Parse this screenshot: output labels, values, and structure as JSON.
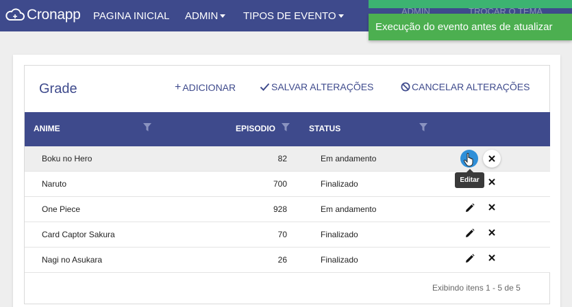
{
  "navbar": {
    "brand": "Cronapp",
    "items": [
      {
        "label": "PAGINA INICIAL",
        "dropdown": false
      },
      {
        "label": "ADMIN",
        "dropdown": true
      },
      {
        "label": "TIPOS DE EVENTO",
        "dropdown": true
      }
    ],
    "partially_hidden": [
      "ADMIN",
      "TROCAR O TEMA"
    ]
  },
  "notification": {
    "message": "Execução do evento antes de atualizar"
  },
  "grid": {
    "title": "Grade",
    "toolbar": {
      "add": "ADICIONAR",
      "save": "SALVAR ALTERAÇÕES",
      "cancel": "CANCELAR ALTERAÇÕES"
    },
    "columns": [
      "ANIME",
      "EPISODIO",
      "STATUS"
    ],
    "rows": [
      {
        "anime": "Boku no Hero",
        "episodio": "82",
        "status": "Em andamento"
      },
      {
        "anime": "Naruto",
        "episodio": "700",
        "status": "Finalizado"
      },
      {
        "anime": "One Piece",
        "episodio": "928",
        "status": "Em andamento"
      },
      {
        "anime": "Card Captor Sakura",
        "episodio": "70",
        "status": "Finalizado"
      },
      {
        "anime": "Nagi no Asukara",
        "episodio": "26",
        "status": "Finalizado"
      }
    ],
    "tooltip": "Editar",
    "footer": "Exibindo itens 1 - 5 de 5"
  },
  "colors": {
    "primary": "#3e4a8c",
    "toast": "#4caf50",
    "edit_active": "#2f8fd8"
  }
}
